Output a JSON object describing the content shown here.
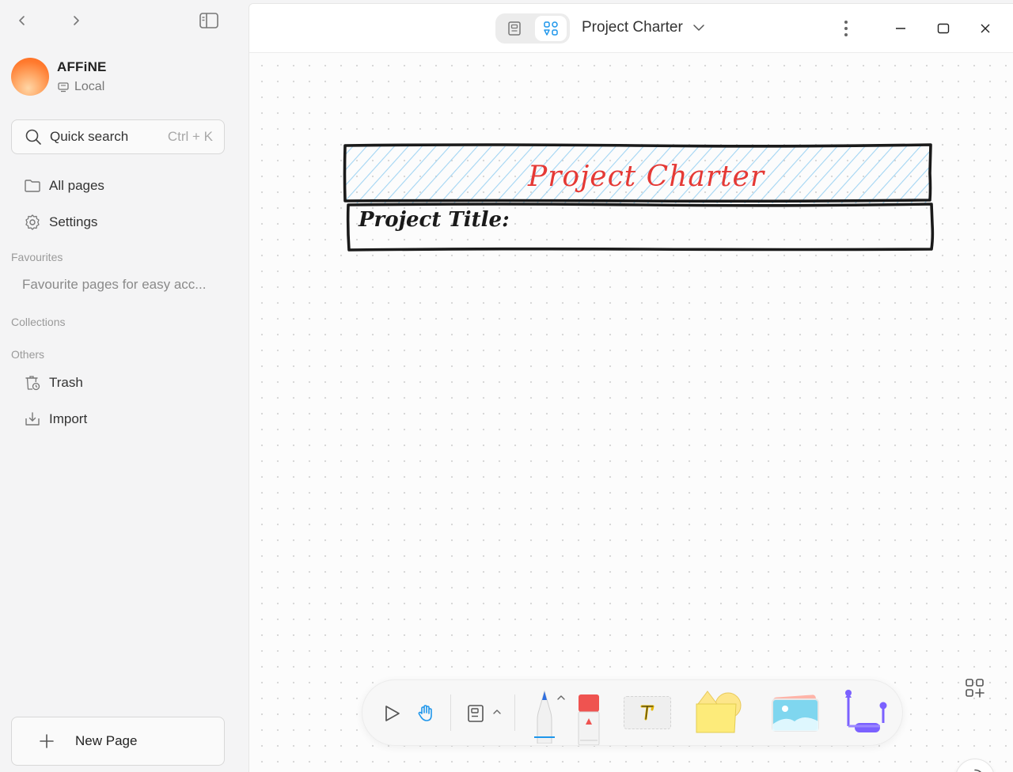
{
  "sidebar": {
    "workspace": {
      "name": "AFFiNE",
      "location": "Local"
    },
    "quick_search": {
      "label": "Quick search",
      "shortcut": "Ctrl + K"
    },
    "nav": [
      {
        "label": "All pages",
        "icon": "folder-icon"
      },
      {
        "label": "Settings",
        "icon": "gear-icon"
      }
    ],
    "favourites": {
      "heading": "Favourites",
      "placeholder": "Favourite pages for easy acc..."
    },
    "collections": {
      "heading": "Collections"
    },
    "others": {
      "heading": "Others",
      "items": [
        {
          "label": "Trash",
          "icon": "trash-icon"
        },
        {
          "label": "Import",
          "icon": "import-icon"
        }
      ]
    },
    "new_page": {
      "label": "New Page"
    }
  },
  "topbar": {
    "modes": [
      "page-mode-icon",
      "edgeless-mode-icon"
    ],
    "active_mode": "edgeless",
    "doc_title": "Project Charter"
  },
  "canvas": {
    "charter": {
      "title": "Project Charter",
      "field_label": "Project Title:",
      "title_color": "#e53935",
      "hatch_color": "#9ed3f2"
    }
  },
  "toolbar": {
    "tools": [
      "select-icon",
      "hand-icon",
      "frame-icon",
      "pen-icon",
      "eraser-icon",
      "text-icon",
      "shape-icon",
      "image-icon",
      "connector-icon"
    ],
    "active_tool": "hand",
    "accent": "#1e96eb"
  }
}
